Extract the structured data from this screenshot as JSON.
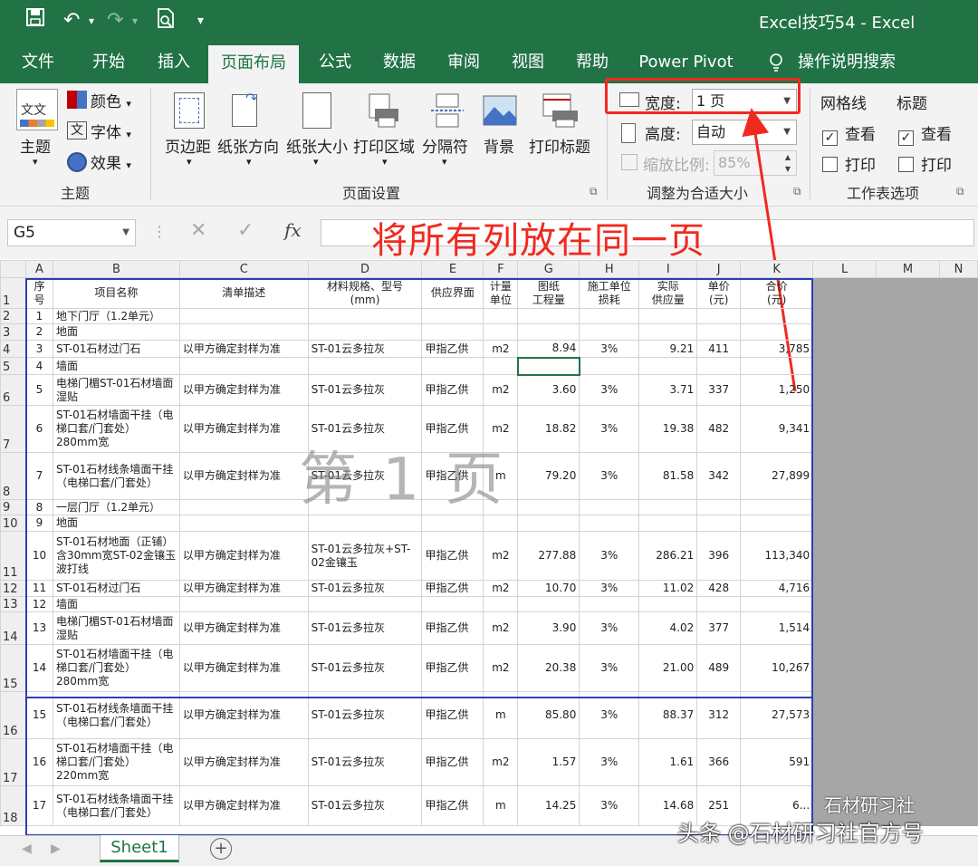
{
  "window": {
    "title": "Excel技巧54 - Excel"
  },
  "tabs": [
    "文件",
    "开始",
    "插入",
    "页面布局",
    "公式",
    "数据",
    "审阅",
    "视图",
    "帮助",
    "Power Pivot",
    "操作说明搜索"
  ],
  "ribbon": {
    "theme": {
      "themes": "主题",
      "colors": "颜色",
      "fonts": "字体",
      "effects": "效果",
      "group": "主题"
    },
    "page_setup": {
      "margins": "页边距",
      "orientation": "纸张方向",
      "size": "纸张大小",
      "print_area": "打印区域",
      "breaks": "分隔符",
      "background": "背景",
      "print_titles": "打印标题",
      "group": "页面设置"
    },
    "scale": {
      "width_label": "宽度:",
      "width_value": "1 页",
      "height_label": "高度:",
      "height_value": "自动",
      "scale_label": "缩放比例:",
      "scale_value": "85%",
      "group": "调整为合适大小"
    },
    "sheet_options": {
      "gridlines": "网格线",
      "headings": "标题",
      "view": "查看",
      "print": "打印",
      "group": "工作表选项"
    }
  },
  "formula_bar": {
    "name_box": "G5",
    "fx": "fx"
  },
  "annotation": "将所有列放在同一页",
  "watermark": "第 1 页",
  "columns": [
    "A",
    "B",
    "C",
    "D",
    "E",
    "F",
    "G",
    "H",
    "I",
    "J",
    "K",
    "L",
    "M",
    "N"
  ],
  "header_row": [
    "序号",
    "项目名称",
    "清单描述",
    "材料规格、型号\n(mm)",
    "供应界面",
    "计量\n单位",
    "图纸\n工程量",
    "施工单位\n损耗",
    "实际\n供应量",
    "单价\n(元)",
    "合价\n(元)"
  ],
  "rows": [
    {
      "n": "2",
      "cells": [
        "1",
        "地下门厅（1.2单元）",
        "",
        "",
        "",
        "",
        "",
        "",
        "",
        "",
        ""
      ]
    },
    {
      "n": "3",
      "cells": [
        "2",
        "地面",
        "",
        "",
        "",
        "",
        "",
        "",
        "",
        "",
        ""
      ]
    },
    {
      "n": "4",
      "cells": [
        "3",
        "ST-01石材过门石",
        "以甲方确定封样为准",
        "ST-01云多拉灰",
        "甲指乙供",
        "m2",
        "8.94",
        "3%",
        "9.21",
        "411",
        "3,785"
      ]
    },
    {
      "n": "5",
      "cells": [
        "4",
        "墙面",
        "",
        "",
        "",
        "",
        "",
        "",
        "",
        "",
        ""
      ]
    },
    {
      "n": "6",
      "cells": [
        "5",
        "电梯门楣ST-01石材墙面湿贴",
        "以甲方确定封样为准",
        "ST-01云多拉灰",
        "甲指乙供",
        "m2",
        "3.60",
        "3%",
        "3.71",
        "337",
        "1,250"
      ]
    },
    {
      "n": "7",
      "cells": [
        "6",
        "ST-01石材墙面干挂（电梯口套/门套处）280mm宽",
        "以甲方确定封样为准",
        "ST-01云多拉灰",
        "甲指乙供",
        "m2",
        "18.82",
        "3%",
        "19.38",
        "482",
        "9,341"
      ]
    },
    {
      "n": "8",
      "cells": [
        "7",
        "ST-01石材线条墙面干挂（电梯口套/门套处）",
        "以甲方确定封样为准",
        "ST-01云多拉灰",
        "甲指乙供",
        "m",
        "79.20",
        "3%",
        "81.58",
        "342",
        "27,899"
      ]
    },
    {
      "n": "9",
      "cells": [
        "8",
        "一层门厅（1.2单元）",
        "",
        "",
        "",
        "",
        "",
        "",
        "",
        "",
        ""
      ]
    },
    {
      "n": "10",
      "cells": [
        "9",
        "地面",
        "",
        "",
        "",
        "",
        "",
        "",
        "",
        "",
        ""
      ]
    },
    {
      "n": "11",
      "cells": [
        "10",
        "ST-01石材地面（正铺）含30mm宽ST-02金镶玉波打线",
        "以甲方确定封样为准",
        "ST-01云多拉灰+ST-02金镶玉",
        "甲指乙供",
        "m2",
        "277.88",
        "3%",
        "286.21",
        "396",
        "113,340"
      ]
    },
    {
      "n": "12",
      "cells": [
        "11",
        "ST-01石材过门石",
        "以甲方确定封样为准",
        "ST-01云多拉灰",
        "甲指乙供",
        "m2",
        "10.70",
        "3%",
        "11.02",
        "428",
        "4,716"
      ]
    },
    {
      "n": "13",
      "cells": [
        "12",
        "墙面",
        "",
        "",
        "",
        "",
        "",
        "",
        "",
        "",
        ""
      ]
    },
    {
      "n": "14",
      "cells": [
        "13",
        "电梯门楣ST-01石材墙面湿贴",
        "以甲方确定封样为准",
        "ST-01云多拉灰",
        "甲指乙供",
        "m2",
        "3.90",
        "3%",
        "4.02",
        "377",
        "1,514"
      ]
    },
    {
      "n": "15",
      "cells": [
        "14",
        "ST-01石材墙面干挂（电梯口套/门套处）280mm宽",
        "以甲方确定封样为准",
        "ST-01云多拉灰",
        "甲指乙供",
        "m2",
        "20.38",
        "3%",
        "21.00",
        "489",
        "10,267"
      ]
    },
    {
      "n": "16",
      "cells": [
        "15",
        "ST-01石材线条墙面干挂（电梯口套/门套处）",
        "以甲方确定封样为准",
        "ST-01云多拉灰",
        "甲指乙供",
        "m",
        "85.80",
        "3%",
        "88.37",
        "312",
        "27,573"
      ]
    },
    {
      "n": "17",
      "cells": [
        "16",
        "ST-01石材墙面干挂（电梯口套/门套处）220mm宽",
        "以甲方确定封样为准",
        "ST-01云多拉灰",
        "甲指乙供",
        "m2",
        "1.57",
        "3%",
        "1.61",
        "366",
        "591"
      ]
    },
    {
      "n": "18",
      "cells": [
        "17",
        "ST-01石材线条墙面干挂（电梯口套/门套处）",
        "以甲方确定封样为准",
        "ST-01云多拉灰",
        "甲指乙供",
        "m",
        "14.25",
        "3%",
        "14.68",
        "251",
        "6..."
      ]
    }
  ],
  "sheet_tab": "Sheet1",
  "credit": "头条 @石材研习社官方号",
  "credit_faint": "石材研习社",
  "colors": {
    "excel_green": "#217346",
    "annotation_red": "#f02a20",
    "page_border": "#2b3fb5"
  }
}
